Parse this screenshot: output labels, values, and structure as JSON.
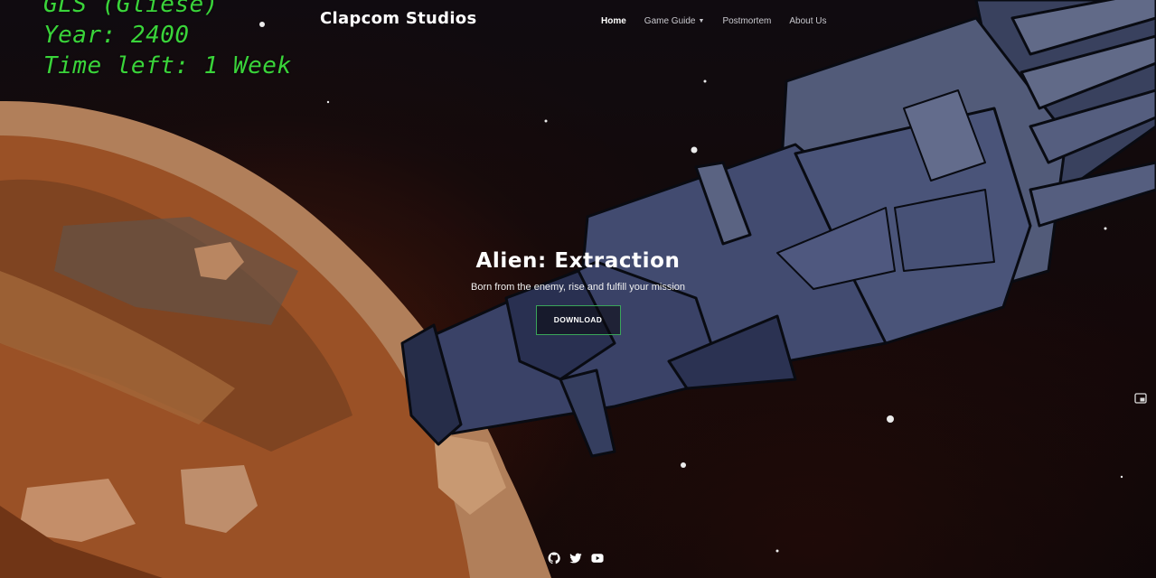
{
  "hud": {
    "line1": "GLS (Gliese)",
    "line2": "Year: 2400",
    "line3": "Time left: 1 Week"
  },
  "brand": "Clapcom Studios",
  "nav": {
    "items": [
      {
        "label": "Home"
      },
      {
        "label": "Game Guide"
      },
      {
        "label": "Postmortem"
      },
      {
        "label": "About Us"
      }
    ]
  },
  "hero": {
    "title": "Alien: Extraction",
    "subtitle": "Born from the enemy, rise and fulfill your mission",
    "button": "DOWNLOAD"
  },
  "social": {
    "icons": [
      "github-icon",
      "twitter-icon",
      "youtube-icon"
    ]
  },
  "colors": {
    "hud_green": "#3ad43a",
    "button_border": "#3aa55a",
    "ship": "#4a5578"
  }
}
